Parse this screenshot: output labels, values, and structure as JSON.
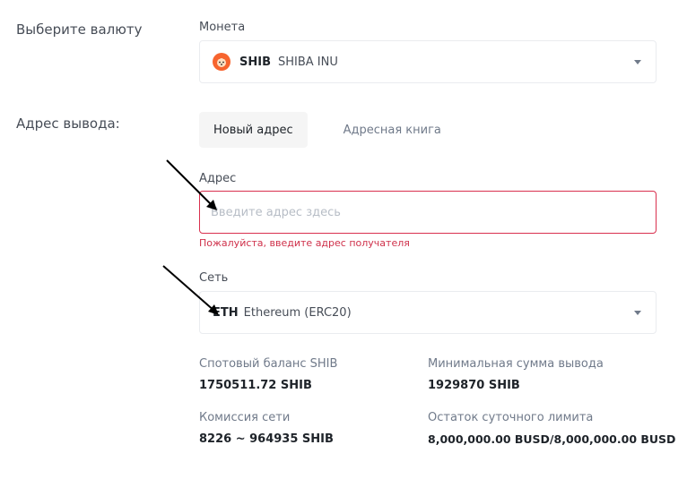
{
  "currency_section": {
    "label": "Выберите валюту",
    "coin_field_label": "Монета",
    "coin": {
      "icon": "shiba-inu-coin-icon",
      "ticker": "SHIB",
      "name": "SHIBA INU",
      "icon_color": "#f7642e"
    }
  },
  "address_section": {
    "label": "Адрес вывода:",
    "tabs": [
      {
        "label": "Новый адрес",
        "active": true
      },
      {
        "label": "Адресная книга",
        "active": false
      }
    ],
    "address_field_label": "Адрес",
    "address_placeholder": "Введите адрес здесь",
    "address_value": "",
    "error_text": "Пожалуйста, введите адрес получателя",
    "error_color": "#cf304a",
    "network_field_label": "Сеть",
    "network": {
      "ticker": "ETH",
      "name": "Ethereum (ERC20)"
    }
  },
  "info": {
    "spot_balance_label": "Спотовый баланс SHIB",
    "spot_balance_value": "1750511.72 SHIB",
    "min_withdraw_label": "Минимальная сумма вывода",
    "min_withdraw_value": "1929870 SHIB",
    "fee_label": "Комиссия сети",
    "fee_value": "8226 ~ 964935 SHIB",
    "daily_limit_label": "Остаток суточного лимита",
    "daily_limit_value": "8,000,000.00 BUSD/8,000,000.00 BUSD"
  },
  "annotations": {
    "arrow_color": "#000000"
  }
}
